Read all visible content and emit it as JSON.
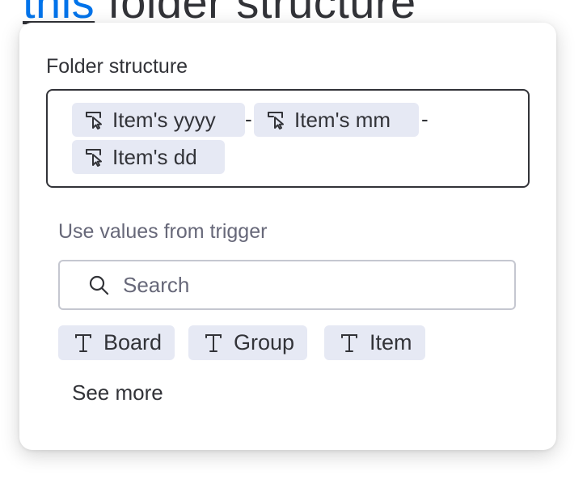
{
  "background": {
    "heading_link": "this",
    "heading_rest": " folder structure"
  },
  "popover": {
    "field_label": "Folder structure",
    "chips": [
      {
        "label": "Item's yyyy",
        "icon": "column-pointer-icon"
      },
      {
        "label": "Item's mm",
        "icon": "column-pointer-icon"
      },
      {
        "label": "Item's dd",
        "icon": "column-pointer-icon"
      }
    ],
    "separator": "-",
    "section_label": "Use values from trigger",
    "search": {
      "placeholder": "Search",
      "value": "",
      "icon": "search-icon"
    },
    "trigger_values": [
      {
        "label": "Board",
        "icon": "text-type-icon"
      },
      {
        "label": "Group",
        "icon": "text-type-icon"
      },
      {
        "label": "Item",
        "icon": "text-type-icon"
      }
    ],
    "see_more": "See more"
  },
  "colors": {
    "chip_bg": "#e6e9f4",
    "text": "#323338",
    "muted": "#676879",
    "link": "#0073ea"
  }
}
